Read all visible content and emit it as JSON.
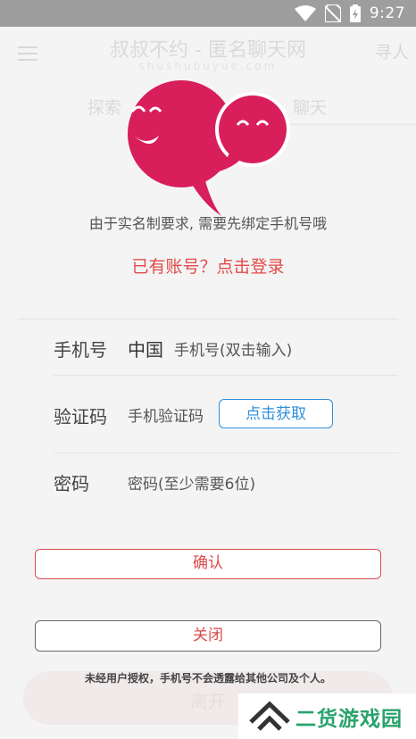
{
  "status_bar": {
    "time": "9:27"
  },
  "background": {
    "title": "叔叔不约 - 匿名聊天网",
    "subtitle": "shushubuyue.com",
    "right_text": "寻人",
    "tab_left": "探索",
    "tab_right": "聊天",
    "bottom_button": "离开"
  },
  "dialog": {
    "prompt": "由于实名制要求, 需要先绑定手机号哦",
    "login_link": "已有账号？点击登录",
    "phone": {
      "label": "手机号",
      "country": "中国",
      "placeholder": "手机号(双击输入)"
    },
    "code": {
      "label": "验证码",
      "placeholder": "手机验证码",
      "button": "点击获取"
    },
    "password": {
      "label": "密码",
      "placeholder": "密码(至少需要6位)"
    },
    "confirm": "确认",
    "close": "关闭",
    "privacy": "未经用户授权，手机号不会透露给其他公司及个人。"
  },
  "watermark": {
    "text": "二货游戏园"
  },
  "colors": {
    "accent_red": "#e24a4a",
    "accent_blue": "#2f8fd8",
    "logo_pink": "#d81e5b",
    "watermark_green": "#2aa36c"
  }
}
